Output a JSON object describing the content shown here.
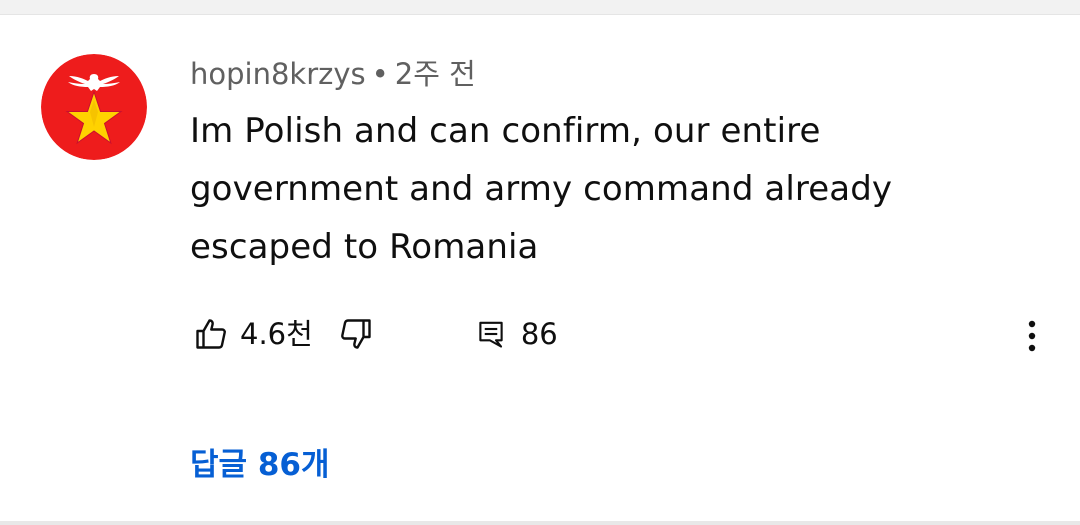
{
  "comment": {
    "author": "hopin8krzys",
    "separator": "•",
    "timestamp": "2주 전",
    "avatar_icon": "red-star-eagle-avatar",
    "text": "Im Polish and can confirm, our entire government and army command already escaped to Romania",
    "like_icon": "thumbs-up-icon",
    "like_count": "4.6천",
    "dislike_icon": "thumbs-down-icon",
    "reply_icon": "reply-comment-icon",
    "reply_count": "86",
    "more_icon": "more-vert-icon",
    "replies_link": "답글 86개"
  },
  "colors": {
    "avatar_background": "#ee1c1c",
    "star": "#ffd200",
    "link": "#065fd4",
    "meta_text": "#606060"
  }
}
